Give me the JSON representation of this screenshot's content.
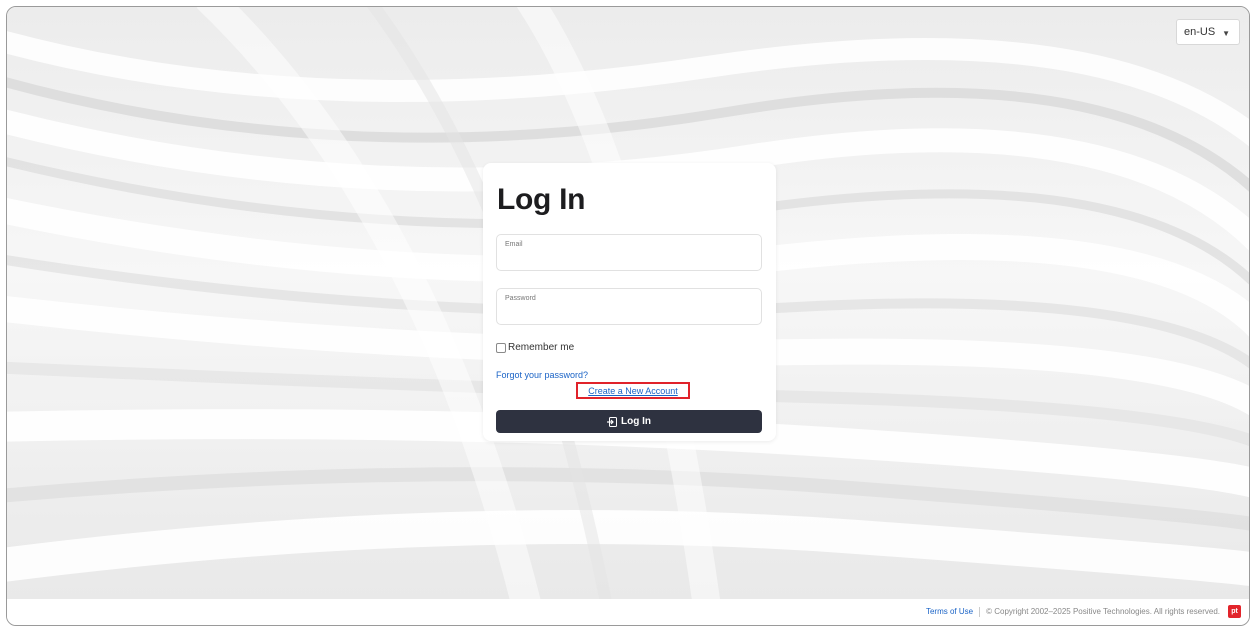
{
  "language": {
    "selected": "en-US"
  },
  "login": {
    "title": "Log In",
    "email_label": "Email",
    "email_value": "",
    "password_label": "Password",
    "password_value": "",
    "remember_label": "Remember me",
    "remember_checked": false,
    "forgot_link": "Forgot your password?",
    "create_link": "Create a New Account",
    "button_label": "Log In"
  },
  "footer": {
    "terms_link": "Terms of Use",
    "copyright": "© Copyright 2002–2025 Positive Technologies. All rights reserved.",
    "logo_text": "pt"
  },
  "colors": {
    "accent_link": "#1a63c6",
    "button_bg": "#2e3240",
    "highlight": "#e0222a",
    "brand": "#e2242b"
  }
}
